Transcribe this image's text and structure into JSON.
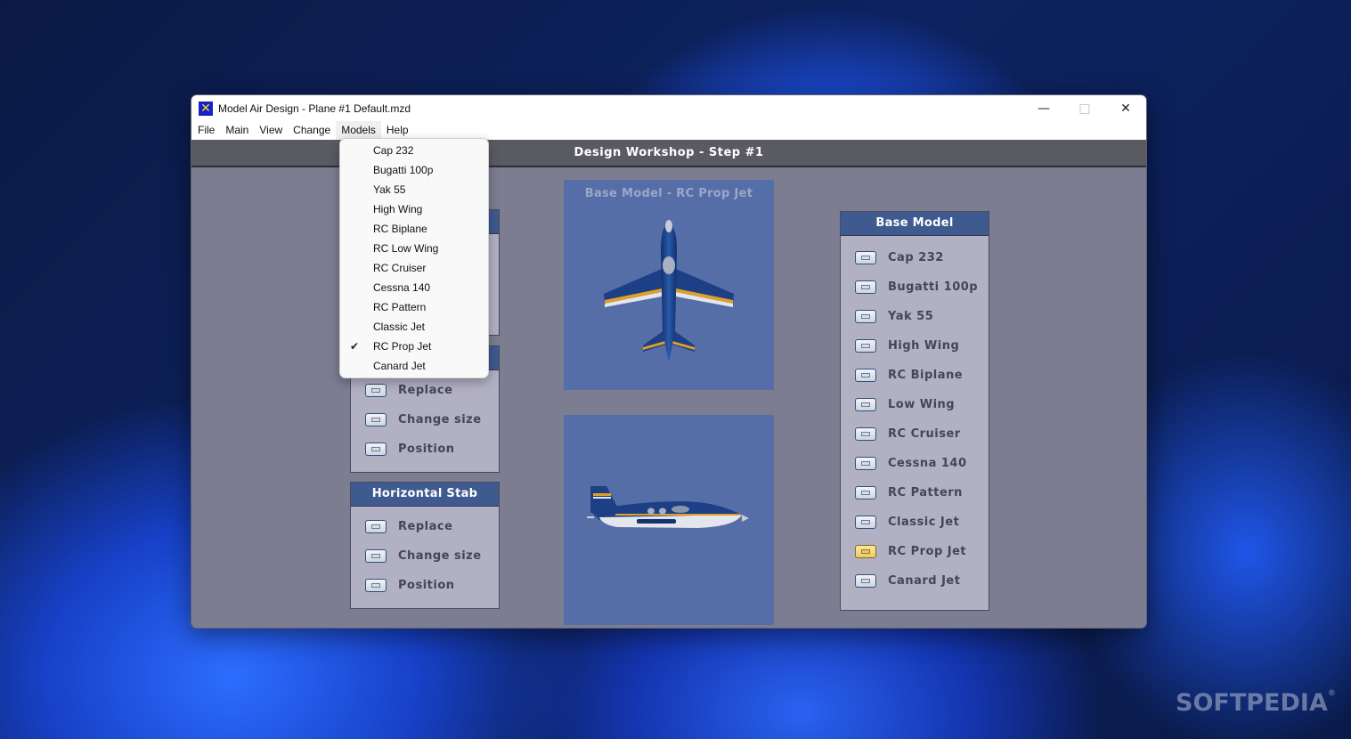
{
  "window": {
    "title": "Model Air Design - Plane #1  Default.mzd",
    "app_icon": "airplane-x-icon",
    "controls": {
      "minimize": "—",
      "maximize": "□",
      "close": "✕"
    }
  },
  "menubar": {
    "items": [
      {
        "label": "File"
      },
      {
        "label": "Main"
      },
      {
        "label": "View"
      },
      {
        "label": "Change"
      },
      {
        "label": "Models",
        "active": true
      },
      {
        "label": "Help"
      }
    ]
  },
  "models_menu": {
    "items": [
      {
        "label": "Cap 232"
      },
      {
        "label": "Bugatti 100p"
      },
      {
        "label": "Yak 55"
      },
      {
        "label": "High Wing"
      },
      {
        "label": "RC Biplane"
      },
      {
        "label": "RC Low Wing"
      },
      {
        "label": "RC Cruiser"
      },
      {
        "label": "Cessna 140"
      },
      {
        "label": "RC Pattern"
      },
      {
        "label": "Classic Jet"
      },
      {
        "label": "RC Prop Jet",
        "checked": true,
        "check_glyph": "✔"
      },
      {
        "label": "Canard Jet"
      }
    ]
  },
  "step_bar": {
    "title": "Design Workshop  -  Step #1"
  },
  "left_panels": [
    {
      "header": "",
      "options": []
    },
    {
      "header": "",
      "options": [
        "Replace",
        "Change size",
        "Position"
      ]
    },
    {
      "header": "Horizontal Stab",
      "options": [
        "Replace",
        "Change size",
        "Position"
      ]
    }
  ],
  "preview": {
    "top_title": "Base Model - RC Prop Jet",
    "top_view": "plane-top-view",
    "side_view": "plane-side-view"
  },
  "base_model_panel": {
    "header": "Base Model",
    "selected": "RC Prop Jet",
    "options": [
      "Cap 232",
      "Bugatti 100p",
      "Yak 55",
      "High Wing",
      "RC Biplane",
      "Low Wing",
      "RC Cruiser",
      "Cessna 140",
      "RC Pattern",
      "Classic Jet",
      "RC Prop Jet",
      "Canard Jet"
    ]
  },
  "colors": {
    "panel_header": "#3f5a8f",
    "panel_body": "#b2b1c3",
    "workspace": "#7c7d91",
    "view_bg": "#566ea8",
    "selected_button": "#f0c860"
  },
  "watermark": {
    "text": "SOFTPEDIA",
    "mark": "®"
  }
}
